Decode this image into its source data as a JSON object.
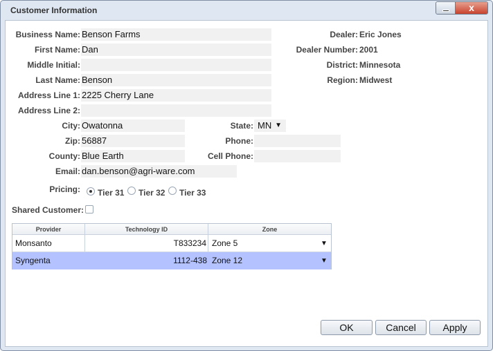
{
  "window": {
    "title": "Customer Information",
    "close_glyph": "x"
  },
  "form": {
    "business_name": {
      "label": "Business Name:",
      "value": "Benson Farms"
    },
    "first_name": {
      "label": "First Name:",
      "value": "Dan"
    },
    "middle_initial": {
      "label": "Middle Initial:",
      "value": ""
    },
    "last_name": {
      "label": "Last Name:",
      "value": "Benson"
    },
    "address1": {
      "label": "Address Line 1:",
      "value": "2225 Cherry Lane"
    },
    "address2": {
      "label": "Address Line 2:",
      "value": ""
    },
    "city": {
      "label": "City:",
      "value": "Owatonna"
    },
    "zip": {
      "label": "Zip:",
      "value": "56887"
    },
    "county": {
      "label": "County:",
      "value": "Blue Earth"
    },
    "email": {
      "label": "Email:",
      "value": "dan.benson@agri-ware.com"
    },
    "state": {
      "label": "State:",
      "value": "MN"
    },
    "phone": {
      "label": "Phone:",
      "value": ""
    },
    "cell_phone": {
      "label": "Cell Phone:",
      "value": ""
    },
    "pricing": {
      "label": "Pricing:",
      "options": [
        "Tier 31",
        "Tier 32",
        "Tier 33"
      ],
      "selected": "Tier 31"
    },
    "shared_customer": {
      "label": "Shared Customer:",
      "checked": false
    }
  },
  "dealer": {
    "dealer": {
      "label": "Dealer:",
      "value": "Eric Jones"
    },
    "dealer_number": {
      "label": "Dealer Number:",
      "value": "2001"
    },
    "district": {
      "label": "District:",
      "value": "Minnesota"
    },
    "region": {
      "label": "Region:",
      "value": "Midwest"
    }
  },
  "grid": {
    "columns": [
      "Provider",
      "Technology ID",
      "Zone"
    ],
    "rows": [
      {
        "provider": "Monsanto",
        "technology_id": "T833234",
        "zone": "Zone 5"
      },
      {
        "provider": "Syngenta",
        "technology_id": "1112-438",
        "zone": "Zone 12"
      }
    ],
    "selected_row": 1
  },
  "buttons": {
    "ok": "OK",
    "cancel": "Cancel",
    "apply": "Apply"
  },
  "colors": {
    "selected_row": "#b4c3ff",
    "field_bg": "#f1f1f1",
    "window_frame": "#dfe7f2"
  }
}
